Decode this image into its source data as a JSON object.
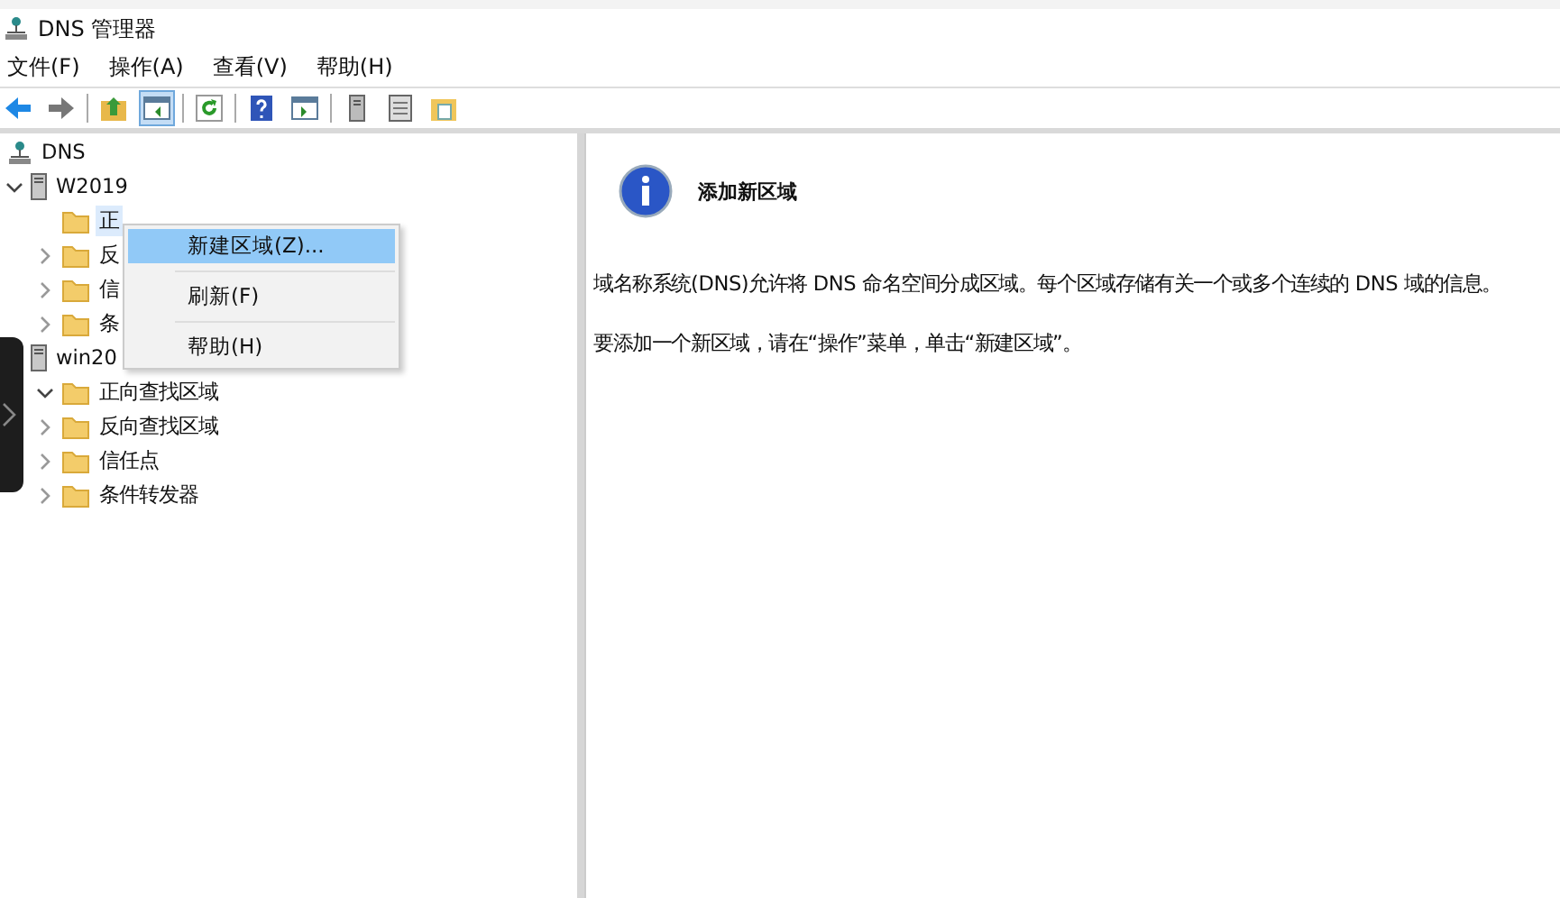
{
  "window": {
    "title": "DNS 管理器"
  },
  "menu_bar": [
    "文件(F)",
    "操作(A)",
    "查看(V)",
    "帮助(H)"
  ],
  "toolbar": [
    {
      "kind": "back",
      "on": false
    },
    {
      "kind": "forward",
      "on": false
    },
    {
      "kind": "sep"
    },
    {
      "kind": "up",
      "on": false
    },
    {
      "kind": "pane",
      "on": true
    },
    {
      "kind": "sep"
    },
    {
      "kind": "refresh",
      "on": false
    },
    {
      "kind": "sep"
    },
    {
      "kind": "help",
      "on": false
    },
    {
      "kind": "panel",
      "on": false
    },
    {
      "kind": "sep"
    },
    {
      "kind": "server",
      "on": false
    },
    {
      "kind": "list",
      "on": false
    },
    {
      "kind": "folder",
      "on": false
    }
  ],
  "tree": [
    {
      "label": "DNS",
      "kind": "root",
      "selected": false,
      "children": [
        {
          "label": "W2019",
          "kind": "server",
          "expanded": true,
          "selected": false,
          "children": [
            {
              "label": "正",
              "kind": "folder",
              "selected": true
            },
            {
              "label": "反",
              "kind": "folder",
              "expanded": false,
              "selected": false
            },
            {
              "label": "信",
              "kind": "folder",
              "expanded": false,
              "selected": false
            },
            {
              "label": "条",
              "kind": "folder",
              "expanded": false,
              "selected": false
            }
          ]
        },
        {
          "label": "win20",
          "kind": "server",
          "selected": false,
          "children": [
            {
              "label": "正向查找区域",
              "kind": "folder",
              "expanded": true,
              "selected": false
            },
            {
              "label": "反向查找区域",
              "kind": "folder",
              "expanded": false,
              "selected": false
            },
            {
              "label": "信任点",
              "kind": "folder",
              "expanded": false,
              "selected": false
            },
            {
              "label": "条件转发器",
              "kind": "folder",
              "expanded": false,
              "selected": false
            }
          ]
        }
      ]
    }
  ],
  "context_menu": [
    {
      "label": "新建区域(Z)...",
      "selected": true
    },
    {
      "label": "刷新(F)",
      "selected": false
    },
    {
      "label": "帮助(H)",
      "selected": false
    }
  ],
  "details": {
    "heading": "添加新区域",
    "paragraphs": [
      "域名称系统(DNS)允许将 DNS 命名空间分成区域。每个区域存储有关一个或多个连续的 DNS 域的信息。",
      "要添加一个新区域，请在“操作”菜单，单击“新建区域”。"
    ]
  }
}
